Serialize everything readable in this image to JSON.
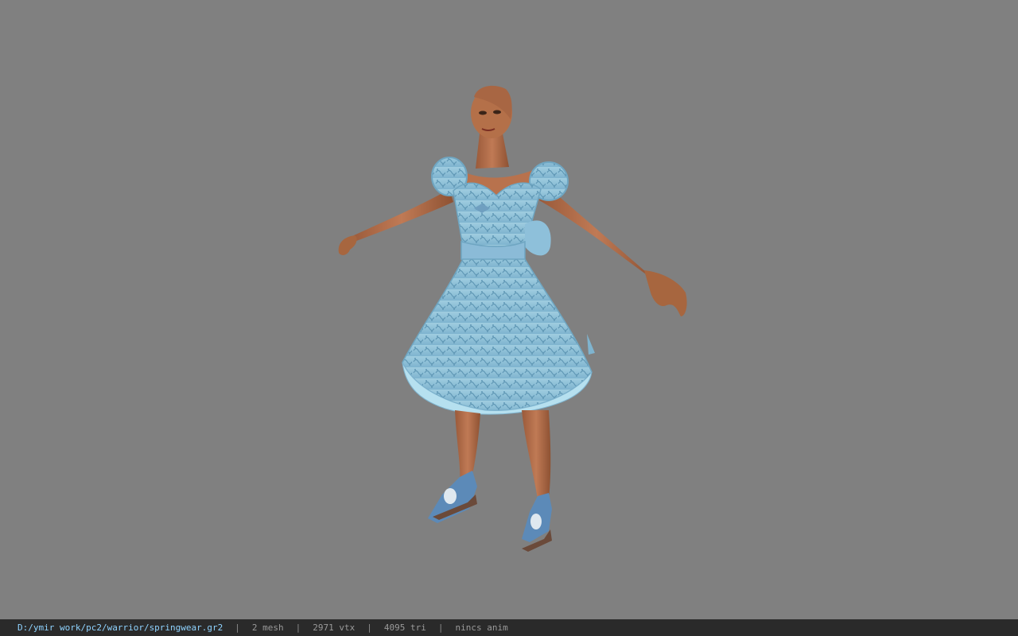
{
  "viewport": {
    "background": "#808080",
    "model_name": "springwear character model"
  },
  "statusbar": {
    "file_path": "D:/ymir work/pc2/warrior/springwear.gr2",
    "separator": "|",
    "mesh_count": "2 mesh",
    "vertex_count": "2971 vtx",
    "triangle_count": "4095 tri",
    "anim_status": "nincs anim",
    "colors": {
      "background": "#2a2a2a",
      "path": "#8fd3ff",
      "stat": "#9a9a9a"
    }
  }
}
